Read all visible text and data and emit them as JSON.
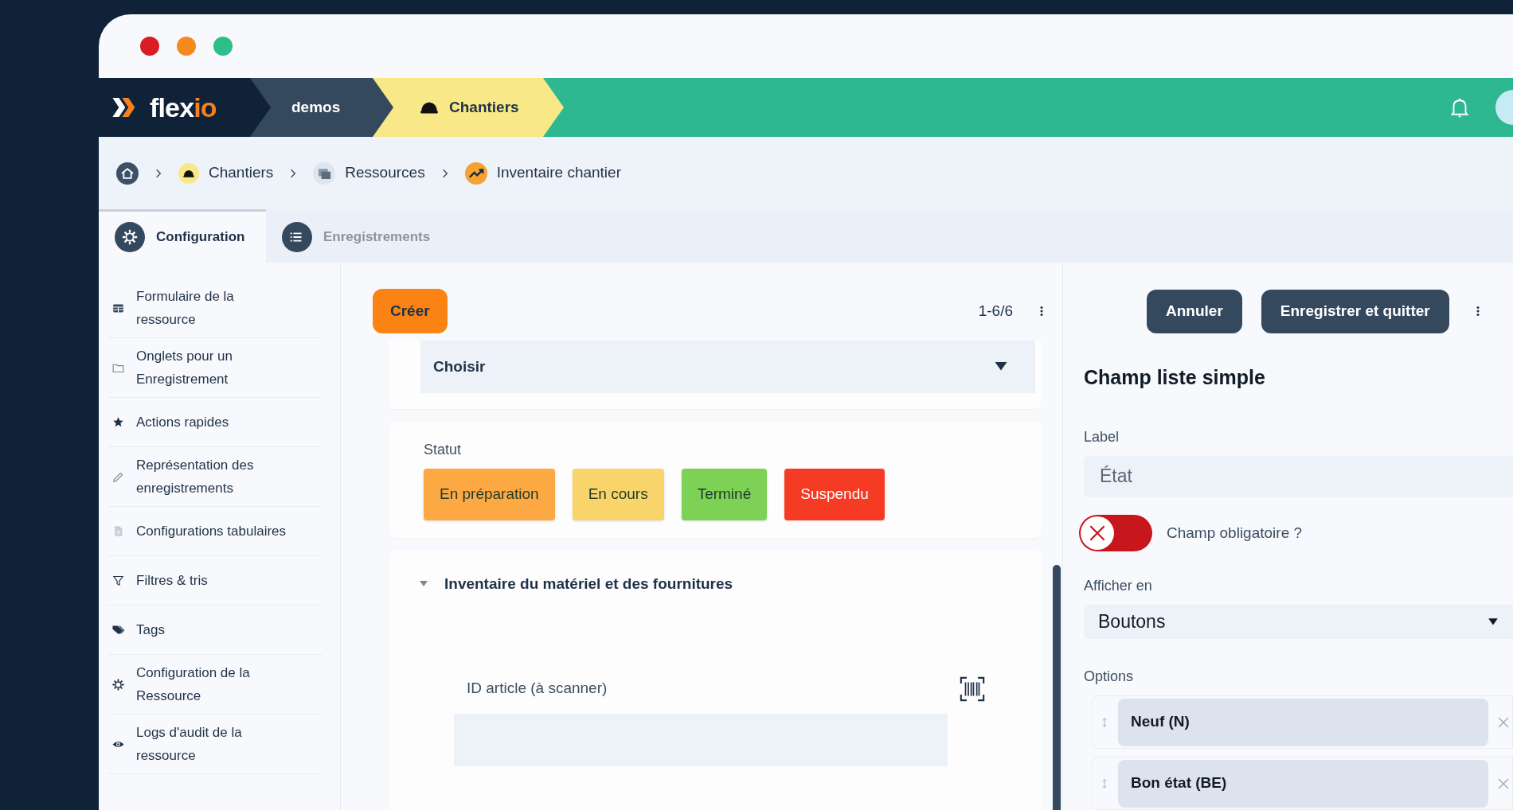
{
  "window_controls": [
    {
      "color": "#d81e22"
    },
    {
      "color": "#f58a1f"
    },
    {
      "color": "#2dbe8a"
    }
  ],
  "header": {
    "logo": {
      "primary": "flex",
      "accent": "io"
    },
    "crumbs": [
      {
        "label": "demos",
        "kind": "plain"
      },
      {
        "label": "Chantiers",
        "kind": "helmet"
      }
    ]
  },
  "breadcrumb": [
    {
      "kind": "home"
    },
    {
      "label": "Chantiers",
      "kind": "helmet"
    },
    {
      "label": "Ressources",
      "kind": "stack"
    },
    {
      "label": "Inventaire chantier",
      "kind": "trend"
    }
  ],
  "tabs": [
    {
      "label": "Configuration",
      "selected": true,
      "kind": "gear"
    },
    {
      "label": "Enregistrements",
      "selected": false,
      "kind": "list"
    }
  ],
  "sidebar": {
    "items": [
      {
        "label": "Formulaire de la\nressource",
        "kind": "table"
      },
      {
        "label": "Onglets pour un\nEnregistrement",
        "kind": "folder"
      },
      {
        "label": "Actions rapides",
        "kind": "star"
      },
      {
        "label": "Représentation des\nenregistrements",
        "kind": "pencil"
      },
      {
        "label": "Configurations tabulaires",
        "kind": "file"
      },
      {
        "label": "Filtres & tris",
        "kind": "filter"
      },
      {
        "label": "Tags",
        "kind": "tags"
      },
      {
        "label": "Configuration de la\nRessource",
        "kind": "gear"
      },
      {
        "label": "Logs d'audit de la\nressource",
        "kind": "eye"
      }
    ]
  },
  "toolbar": {
    "create_button": "Créer",
    "pagination": "1-6/6"
  },
  "form": {
    "select": {
      "value": "Choisir"
    },
    "status": {
      "label": "Statut",
      "options": [
        {
          "label": "En préparation",
          "color": "#fca944"
        },
        {
          "label": "En cours",
          "color": "#f9d46a"
        },
        {
          "label": "Terminé",
          "color": "#7dd155"
        },
        {
          "label": "Suspendu",
          "color": "#f63b24"
        }
      ]
    },
    "section": {
      "title": "Inventaire du matériel et des fournitures",
      "expanded": true
    },
    "field": {
      "label": "ID article (à scanner)"
    }
  },
  "editor": {
    "buttons": [
      "Annuler",
      "Enregistrer et quitter"
    ],
    "title": "Champ liste simple",
    "label_field": {
      "label": "Label",
      "value": "État"
    },
    "required_toggle": {
      "label": "Champ obligatoire ?",
      "on": false
    },
    "display_select": {
      "label": "Afficher en",
      "value": "Boutons"
    },
    "options": {
      "label": "Options",
      "items": [
        "Neuf (N)",
        "Bon état (BE)"
      ]
    }
  }
}
